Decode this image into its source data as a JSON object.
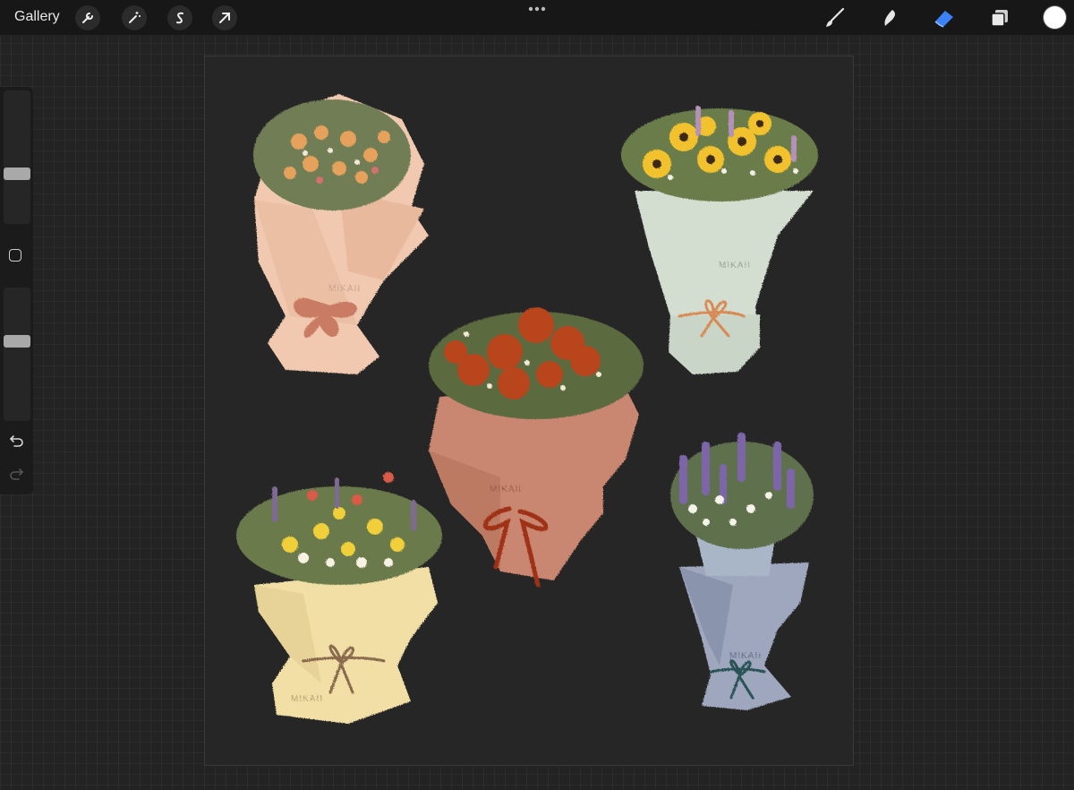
{
  "toolbar": {
    "gallery_label": "Gallery",
    "left_tools": [
      {
        "name": "actions",
        "icon": "wrench-icon"
      },
      {
        "name": "adjustments",
        "icon": "magic-wand-icon"
      },
      {
        "name": "selection",
        "icon": "selection-s-icon"
      },
      {
        "name": "transform",
        "icon": "arrow-cursor-icon"
      }
    ],
    "menu_icon": "more-dots-icon",
    "right_tools": [
      {
        "name": "brush",
        "icon": "brush-icon"
      },
      {
        "name": "smudge",
        "icon": "smudge-icon"
      },
      {
        "name": "eraser",
        "icon": "eraser-icon",
        "active": true,
        "accent": "#3b82f6"
      },
      {
        "name": "layers",
        "icon": "layers-icon"
      }
    ],
    "current_color": "#ffffff"
  },
  "sidebar": {
    "brush_size_level": 0.62,
    "opacity_level": 0.61,
    "undo_icon": "undo-icon",
    "redo_icon": "redo-icon"
  },
  "canvas": {
    "bouquets": [
      {
        "name": "peach-bouquet",
        "wrap_color": "#f1c9b0",
        "ribbon_color": "#c97b63",
        "watermark": "MIKAII"
      },
      {
        "name": "sunflower-bouquet",
        "wrap_color": "#d3ddd0",
        "ribbon_color": "#d98952",
        "watermark": "MIKAII"
      },
      {
        "name": "rose-bouquet",
        "wrap_color": "#c98670",
        "ribbon_color": "#a83a20",
        "watermark": "MIKAII"
      },
      {
        "name": "wildflower-bouquet",
        "wrap_color": "#f2dfa6",
        "ribbon_color": "#8a6a4e",
        "watermark": "MIKAII"
      },
      {
        "name": "lavender-bouquet",
        "wrap_color": "#9ea7bd",
        "ribbon_color": "#2c5256",
        "watermark": "MIKAII"
      }
    ]
  }
}
